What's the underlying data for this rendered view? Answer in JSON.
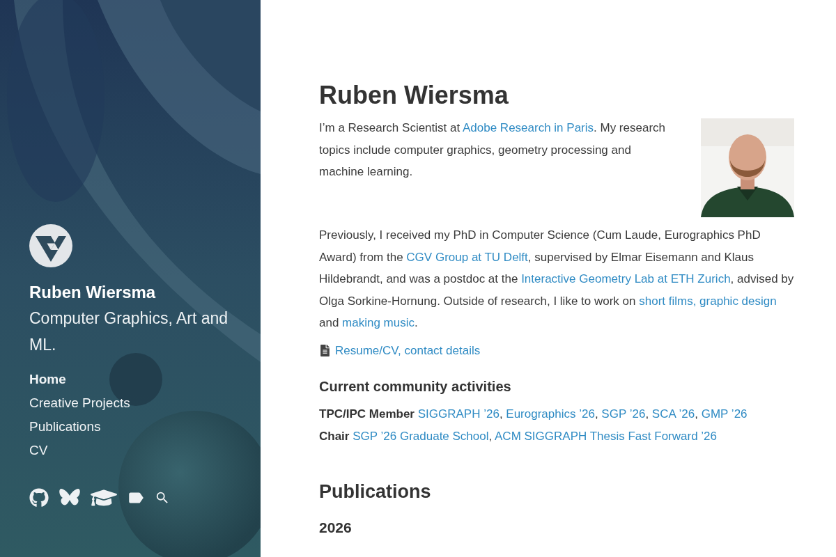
{
  "sidebar": {
    "name": "Ruben Wiersma",
    "tagline": "Computer Graphics, Art and ML.",
    "nav": [
      {
        "label": "Home",
        "selected": true
      },
      {
        "label": "Creative Projects",
        "selected": false
      },
      {
        "label": "Publications",
        "selected": false
      },
      {
        "label": "CV",
        "selected": false
      }
    ],
    "social": [
      {
        "kind": "github"
      },
      {
        "kind": "butterfly"
      },
      {
        "kind": "cap"
      },
      {
        "kind": "tag"
      },
      {
        "kind": "search"
      }
    ]
  },
  "main": {
    "title": "Ruben Wiersma",
    "photo": {
      "kind": "picture"
    },
    "paragraphs": [
      [
        {
          "text": "I’m a Research Scientist at "
        },
        {
          "text": "Adobe Research in Paris",
          "link": true
        },
        {
          "text": ". My research topics include computer graphics, geometry processing and machine learning."
        }
      ],
      [
        {
          "text": "Previously, I received my PhD in Computer Science (Cum Laude, Eurographics PhD Award) from the "
        },
        {
          "text": "CGV Group at TU Delft",
          "link": true
        },
        {
          "text": ", supervised by Elmar Eisemann and Klaus Hildebrandt, and was a postdoc at the "
        },
        {
          "text": "Interactive Geometry Lab at ETH Zurich",
          "link": true
        },
        {
          "text": ", advised by Olga Sorkine-Hornung. Outside of research, I like to work on "
        },
        {
          "text": "short films, graphic design",
          "link": true
        },
        {
          "text": " and "
        },
        {
          "text": "making music",
          "link": true
        },
        {
          "text": "."
        }
      ]
    ],
    "cv_link": "Resume/CV, contact details",
    "community": {
      "heading": "Current community activities",
      "lines": [
        {
          "segments": [
            {
              "text": "TPC/IPC Member",
              "bold": true
            },
            {
              "text": "SIGGRAPH ’26",
              "link": true
            },
            {
              "text": ", "
            },
            {
              "text": "Eurographics ’26",
              "link": true
            },
            {
              "text": ", "
            },
            {
              "text": "SGP ’26",
              "link": true
            },
            {
              "text": ", "
            },
            {
              "text": "SCA ’26",
              "link": true
            },
            {
              "text": ", "
            },
            {
              "text": "GMP ’26",
              "link": true
            }
          ]
        },
        {
          "segments": [
            {
              "text": "Chair",
              "bold": true
            },
            {
              "text": "SGP ’26 Graduate School",
              "link": true
            },
            {
              "text": ", "
            },
            {
              "text": "ACM SIGGRAPH Thesis Fast Forward ’26",
              "link": true
            }
          ]
        }
      ]
    },
    "publications_heading": "Publications",
    "year": "2026"
  }
}
